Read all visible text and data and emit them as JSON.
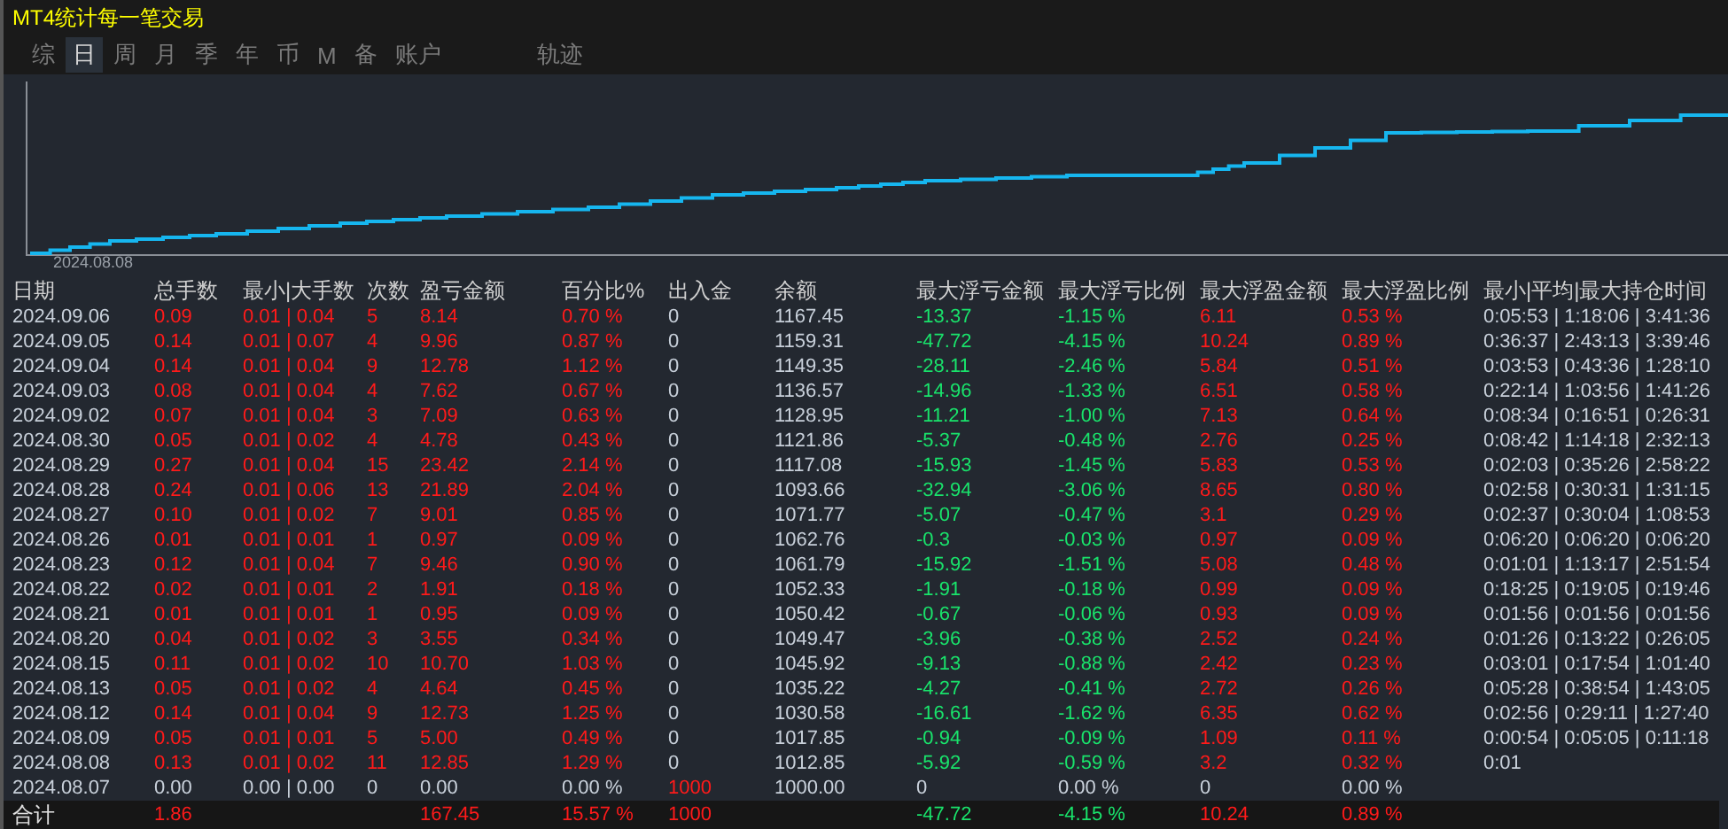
{
  "window": {
    "title": "MT4统计每一笔交易"
  },
  "tabs": [
    {
      "label": "综",
      "selected": false
    },
    {
      "label": "日",
      "selected": true
    },
    {
      "label": "周",
      "selected": false
    },
    {
      "label": "月",
      "selected": false
    },
    {
      "label": "季",
      "selected": false
    },
    {
      "label": "年",
      "selected": false
    },
    {
      "label": "币",
      "selected": false
    },
    {
      "label": "M",
      "selected": false
    },
    {
      "label": "备",
      "selected": false
    },
    {
      "label": "账户",
      "selected": false
    },
    {
      "label": "轨迹",
      "selected": false
    }
  ],
  "chart": {
    "start_label": "2024.08.08"
  },
  "table": {
    "columns": [
      "日期",
      "总手数",
      "最小|大手数",
      "次数",
      "盈亏金额",
      "百分比%",
      "出入金",
      "余额",
      "最大浮亏金额",
      "最大浮亏比例",
      "最大浮盈金额",
      "最大浮盈比例",
      "最小|平均|最大持仓时间"
    ],
    "rows": [
      {
        "cells": [
          {
            "text": "2024.09.06",
            "color": "#c8d0da"
          },
          {
            "text": "0.09",
            "color": "#ff1a1a"
          },
          {
            "text": "0.01 | 0.04",
            "color": "#ff1a1a"
          },
          {
            "text": "5",
            "color": "#ff1a1a"
          },
          {
            "text": "8.14",
            "color": "#ff1a1a"
          },
          {
            "text": "0.70 %",
            "color": "#ff1a1a"
          },
          {
            "text": "0",
            "color": "#c8d0da"
          },
          {
            "text": "1167.45",
            "color": "#c8d0da"
          },
          {
            "text": "-13.37",
            "color": "#19e36b"
          },
          {
            "text": "-1.15 %",
            "color": "#19e36b"
          },
          {
            "text": "6.11",
            "color": "#ff1a1a"
          },
          {
            "text": "0.53 %",
            "color": "#ff1a1a"
          },
          {
            "text": "0:05:53 | 1:18:06 | 3:41:36",
            "color": "#c8d0da"
          }
        ]
      },
      {
        "cells": [
          {
            "text": "2024.09.05",
            "color": "#c8d0da"
          },
          {
            "text": "0.14",
            "color": "#ff1a1a"
          },
          {
            "text": "0.01 | 0.07",
            "color": "#ff1a1a"
          },
          {
            "text": "4",
            "color": "#ff1a1a"
          },
          {
            "text": "9.96",
            "color": "#ff1a1a"
          },
          {
            "text": "0.87 %",
            "color": "#ff1a1a"
          },
          {
            "text": "0",
            "color": "#c8d0da"
          },
          {
            "text": "1159.31",
            "color": "#c8d0da"
          },
          {
            "text": "-47.72",
            "color": "#19e36b"
          },
          {
            "text": "-4.15 %",
            "color": "#19e36b"
          },
          {
            "text": "10.24",
            "color": "#ff1a1a"
          },
          {
            "text": "0.89 %",
            "color": "#ff1a1a"
          },
          {
            "text": "0:36:37 | 2:43:13 | 3:39:46",
            "color": "#c8d0da"
          }
        ]
      },
      {
        "cells": [
          {
            "text": "2024.09.04",
            "color": "#c8d0da"
          },
          {
            "text": "0.14",
            "color": "#ff1a1a"
          },
          {
            "text": "0.01 | 0.04",
            "color": "#ff1a1a"
          },
          {
            "text": "9",
            "color": "#ff1a1a"
          },
          {
            "text": "12.78",
            "color": "#ff1a1a"
          },
          {
            "text": "1.12 %",
            "color": "#ff1a1a"
          },
          {
            "text": "0",
            "color": "#c8d0da"
          },
          {
            "text": "1149.35",
            "color": "#c8d0da"
          },
          {
            "text": "-28.11",
            "color": "#19e36b"
          },
          {
            "text": "-2.46 %",
            "color": "#19e36b"
          },
          {
            "text": "5.84",
            "color": "#ff1a1a"
          },
          {
            "text": "0.51 %",
            "color": "#ff1a1a"
          },
          {
            "text": "0:03:53 | 0:43:36 | 1:28:10",
            "color": "#c8d0da"
          }
        ]
      },
      {
        "cells": [
          {
            "text": "2024.09.03",
            "color": "#c8d0da"
          },
          {
            "text": "0.08",
            "color": "#ff1a1a"
          },
          {
            "text": "0.01 | 0.04",
            "color": "#ff1a1a"
          },
          {
            "text": "4",
            "color": "#ff1a1a"
          },
          {
            "text": "7.62",
            "color": "#ff1a1a"
          },
          {
            "text": "0.67 %",
            "color": "#ff1a1a"
          },
          {
            "text": "0",
            "color": "#c8d0da"
          },
          {
            "text": "1136.57",
            "color": "#c8d0da"
          },
          {
            "text": "-14.96",
            "color": "#19e36b"
          },
          {
            "text": "-1.33 %",
            "color": "#19e36b"
          },
          {
            "text": "6.51",
            "color": "#ff1a1a"
          },
          {
            "text": "0.58 %",
            "color": "#ff1a1a"
          },
          {
            "text": "0:22:14 | 1:03:56 | 1:41:26",
            "color": "#c8d0da"
          }
        ]
      },
      {
        "cells": [
          {
            "text": "2024.09.02",
            "color": "#c8d0da"
          },
          {
            "text": "0.07",
            "color": "#ff1a1a"
          },
          {
            "text": "0.01 | 0.04",
            "color": "#ff1a1a"
          },
          {
            "text": "3",
            "color": "#ff1a1a"
          },
          {
            "text": "7.09",
            "color": "#ff1a1a"
          },
          {
            "text": "0.63 %",
            "color": "#ff1a1a"
          },
          {
            "text": "0",
            "color": "#c8d0da"
          },
          {
            "text": "1128.95",
            "color": "#c8d0da"
          },
          {
            "text": "-11.21",
            "color": "#19e36b"
          },
          {
            "text": "-1.00 %",
            "color": "#19e36b"
          },
          {
            "text": "7.13",
            "color": "#ff1a1a"
          },
          {
            "text": "0.64 %",
            "color": "#ff1a1a"
          },
          {
            "text": "0:08:34 | 0:16:51 | 0:26:31",
            "color": "#c8d0da"
          }
        ]
      },
      {
        "cells": [
          {
            "text": "2024.08.30",
            "color": "#c8d0da"
          },
          {
            "text": "0.05",
            "color": "#ff1a1a"
          },
          {
            "text": "0.01 | 0.02",
            "color": "#ff1a1a"
          },
          {
            "text": "4",
            "color": "#ff1a1a"
          },
          {
            "text": "4.78",
            "color": "#ff1a1a"
          },
          {
            "text": "0.43 %",
            "color": "#ff1a1a"
          },
          {
            "text": "0",
            "color": "#c8d0da"
          },
          {
            "text": "1121.86",
            "color": "#c8d0da"
          },
          {
            "text": "-5.37",
            "color": "#19e36b"
          },
          {
            "text": "-0.48 %",
            "color": "#19e36b"
          },
          {
            "text": "2.76",
            "color": "#ff1a1a"
          },
          {
            "text": "0.25 %",
            "color": "#ff1a1a"
          },
          {
            "text": "0:08:42 | 1:14:18 | 2:32:13",
            "color": "#c8d0da"
          }
        ]
      },
      {
        "cells": [
          {
            "text": "2024.08.29",
            "color": "#c8d0da"
          },
          {
            "text": "0.27",
            "color": "#ff1a1a"
          },
          {
            "text": "0.01 | 0.04",
            "color": "#ff1a1a"
          },
          {
            "text": "15",
            "color": "#ff1a1a"
          },
          {
            "text": "23.42",
            "color": "#ff1a1a"
          },
          {
            "text": "2.14 %",
            "color": "#ff1a1a"
          },
          {
            "text": "0",
            "color": "#c8d0da"
          },
          {
            "text": "1117.08",
            "color": "#c8d0da"
          },
          {
            "text": "-15.93",
            "color": "#19e36b"
          },
          {
            "text": "-1.45 %",
            "color": "#19e36b"
          },
          {
            "text": "5.83",
            "color": "#ff1a1a"
          },
          {
            "text": "0.53 %",
            "color": "#ff1a1a"
          },
          {
            "text": "0:02:03 | 0:35:26 | 2:58:22",
            "color": "#c8d0da"
          }
        ]
      },
      {
        "cells": [
          {
            "text": "2024.08.28",
            "color": "#c8d0da"
          },
          {
            "text": "0.24",
            "color": "#ff1a1a"
          },
          {
            "text": "0.01 | 0.06",
            "color": "#ff1a1a"
          },
          {
            "text": "13",
            "color": "#ff1a1a"
          },
          {
            "text": "21.89",
            "color": "#ff1a1a"
          },
          {
            "text": "2.04 %",
            "color": "#ff1a1a"
          },
          {
            "text": "0",
            "color": "#c8d0da"
          },
          {
            "text": "1093.66",
            "color": "#c8d0da"
          },
          {
            "text": "-32.94",
            "color": "#19e36b"
          },
          {
            "text": "-3.06 %",
            "color": "#19e36b"
          },
          {
            "text": "8.65",
            "color": "#ff1a1a"
          },
          {
            "text": "0.80 %",
            "color": "#ff1a1a"
          },
          {
            "text": "0:02:58 | 0:30:31 | 1:31:15",
            "color": "#c8d0da"
          }
        ]
      },
      {
        "cells": [
          {
            "text": "2024.08.27",
            "color": "#c8d0da"
          },
          {
            "text": "0.10",
            "color": "#ff1a1a"
          },
          {
            "text": "0.01 | 0.02",
            "color": "#ff1a1a"
          },
          {
            "text": "7",
            "color": "#ff1a1a"
          },
          {
            "text": "9.01",
            "color": "#ff1a1a"
          },
          {
            "text": "0.85 %",
            "color": "#ff1a1a"
          },
          {
            "text": "0",
            "color": "#c8d0da"
          },
          {
            "text": "1071.77",
            "color": "#c8d0da"
          },
          {
            "text": "-5.07",
            "color": "#19e36b"
          },
          {
            "text": "-0.47 %",
            "color": "#19e36b"
          },
          {
            "text": "3.1",
            "color": "#ff1a1a"
          },
          {
            "text": "0.29 %",
            "color": "#ff1a1a"
          },
          {
            "text": "0:02:37 | 0:30:04 | 1:08:53",
            "color": "#c8d0da"
          }
        ]
      },
      {
        "cells": [
          {
            "text": "2024.08.26",
            "color": "#c8d0da"
          },
          {
            "text": "0.01",
            "color": "#ff1a1a"
          },
          {
            "text": "0.01 | 0.01",
            "color": "#ff1a1a"
          },
          {
            "text": "1",
            "color": "#ff1a1a"
          },
          {
            "text": "0.97",
            "color": "#ff1a1a"
          },
          {
            "text": "0.09 %",
            "color": "#ff1a1a"
          },
          {
            "text": "0",
            "color": "#c8d0da"
          },
          {
            "text": "1062.76",
            "color": "#c8d0da"
          },
          {
            "text": "-0.3",
            "color": "#19e36b"
          },
          {
            "text": "-0.03 %",
            "color": "#19e36b"
          },
          {
            "text": "0.97",
            "color": "#ff1a1a"
          },
          {
            "text": "0.09 %",
            "color": "#ff1a1a"
          },
          {
            "text": "0:06:20 | 0:06:20 | 0:06:20",
            "color": "#c8d0da"
          }
        ]
      },
      {
        "cells": [
          {
            "text": "2024.08.23",
            "color": "#c8d0da"
          },
          {
            "text": "0.12",
            "color": "#ff1a1a"
          },
          {
            "text": "0.01 | 0.04",
            "color": "#ff1a1a"
          },
          {
            "text": "7",
            "color": "#ff1a1a"
          },
          {
            "text": "9.46",
            "color": "#ff1a1a"
          },
          {
            "text": "0.90 %",
            "color": "#ff1a1a"
          },
          {
            "text": "0",
            "color": "#c8d0da"
          },
          {
            "text": "1061.79",
            "color": "#c8d0da"
          },
          {
            "text": "-15.92",
            "color": "#19e36b"
          },
          {
            "text": "-1.51 %",
            "color": "#19e36b"
          },
          {
            "text": "5.08",
            "color": "#ff1a1a"
          },
          {
            "text": "0.48 %",
            "color": "#ff1a1a"
          },
          {
            "text": "0:01:01 | 1:13:17 | 2:51:54",
            "color": "#c8d0da"
          }
        ]
      },
      {
        "cells": [
          {
            "text": "2024.08.22",
            "color": "#c8d0da"
          },
          {
            "text": "0.02",
            "color": "#ff1a1a"
          },
          {
            "text": "0.01 | 0.01",
            "color": "#ff1a1a"
          },
          {
            "text": "2",
            "color": "#ff1a1a"
          },
          {
            "text": "1.91",
            "color": "#ff1a1a"
          },
          {
            "text": "0.18 %",
            "color": "#ff1a1a"
          },
          {
            "text": "0",
            "color": "#c8d0da"
          },
          {
            "text": "1052.33",
            "color": "#c8d0da"
          },
          {
            "text": "-1.91",
            "color": "#19e36b"
          },
          {
            "text": "-0.18 %",
            "color": "#19e36b"
          },
          {
            "text": "0.99",
            "color": "#ff1a1a"
          },
          {
            "text": "0.09 %",
            "color": "#ff1a1a"
          },
          {
            "text": "0:18:25 | 0:19:05 | 0:19:46",
            "color": "#c8d0da"
          }
        ]
      },
      {
        "cells": [
          {
            "text": "2024.08.21",
            "color": "#c8d0da"
          },
          {
            "text": "0.01",
            "color": "#ff1a1a"
          },
          {
            "text": "0.01 | 0.01",
            "color": "#ff1a1a"
          },
          {
            "text": "1",
            "color": "#ff1a1a"
          },
          {
            "text": "0.95",
            "color": "#ff1a1a"
          },
          {
            "text": "0.09 %",
            "color": "#ff1a1a"
          },
          {
            "text": "0",
            "color": "#c8d0da"
          },
          {
            "text": "1050.42",
            "color": "#c8d0da"
          },
          {
            "text": "-0.67",
            "color": "#19e36b"
          },
          {
            "text": "-0.06 %",
            "color": "#19e36b"
          },
          {
            "text": "0.93",
            "color": "#ff1a1a"
          },
          {
            "text": "0.09 %",
            "color": "#ff1a1a"
          },
          {
            "text": "0:01:56 | 0:01:56 | 0:01:56",
            "color": "#c8d0da"
          }
        ]
      },
      {
        "cells": [
          {
            "text": "2024.08.20",
            "color": "#c8d0da"
          },
          {
            "text": "0.04",
            "color": "#ff1a1a"
          },
          {
            "text": "0.01 | 0.02",
            "color": "#ff1a1a"
          },
          {
            "text": "3",
            "color": "#ff1a1a"
          },
          {
            "text": "3.55",
            "color": "#ff1a1a"
          },
          {
            "text": "0.34 %",
            "color": "#ff1a1a"
          },
          {
            "text": "0",
            "color": "#c8d0da"
          },
          {
            "text": "1049.47",
            "color": "#c8d0da"
          },
          {
            "text": "-3.96",
            "color": "#19e36b"
          },
          {
            "text": "-0.38 %",
            "color": "#19e36b"
          },
          {
            "text": "2.52",
            "color": "#ff1a1a"
          },
          {
            "text": "0.24 %",
            "color": "#ff1a1a"
          },
          {
            "text": "0:01:26 | 0:13:22 | 0:26:05",
            "color": "#c8d0da"
          }
        ]
      },
      {
        "cells": [
          {
            "text": "2024.08.15",
            "color": "#c8d0da"
          },
          {
            "text": "0.11",
            "color": "#ff1a1a"
          },
          {
            "text": "0.01 | 0.02",
            "color": "#ff1a1a"
          },
          {
            "text": "10",
            "color": "#ff1a1a"
          },
          {
            "text": "10.70",
            "color": "#ff1a1a"
          },
          {
            "text": "1.03 %",
            "color": "#ff1a1a"
          },
          {
            "text": "0",
            "color": "#c8d0da"
          },
          {
            "text": "1045.92",
            "color": "#c8d0da"
          },
          {
            "text": "-9.13",
            "color": "#19e36b"
          },
          {
            "text": "-0.88 %",
            "color": "#19e36b"
          },
          {
            "text": "2.42",
            "color": "#ff1a1a"
          },
          {
            "text": "0.23 %",
            "color": "#ff1a1a"
          },
          {
            "text": "0:03:01 | 0:17:54 | 1:01:40",
            "color": "#c8d0da"
          }
        ]
      },
      {
        "cells": [
          {
            "text": "2024.08.13",
            "color": "#c8d0da"
          },
          {
            "text": "0.05",
            "color": "#ff1a1a"
          },
          {
            "text": "0.01 | 0.02",
            "color": "#ff1a1a"
          },
          {
            "text": "4",
            "color": "#ff1a1a"
          },
          {
            "text": "4.64",
            "color": "#ff1a1a"
          },
          {
            "text": "0.45 %",
            "color": "#ff1a1a"
          },
          {
            "text": "0",
            "color": "#c8d0da"
          },
          {
            "text": "1035.22",
            "color": "#c8d0da"
          },
          {
            "text": "-4.27",
            "color": "#19e36b"
          },
          {
            "text": "-0.41 %",
            "color": "#19e36b"
          },
          {
            "text": "2.72",
            "color": "#ff1a1a"
          },
          {
            "text": "0.26 %",
            "color": "#ff1a1a"
          },
          {
            "text": "0:05:28 | 0:38:54 | 1:43:05",
            "color": "#c8d0da"
          }
        ]
      },
      {
        "cells": [
          {
            "text": "2024.08.12",
            "color": "#c8d0da"
          },
          {
            "text": "0.14",
            "color": "#ff1a1a"
          },
          {
            "text": "0.01 | 0.04",
            "color": "#ff1a1a"
          },
          {
            "text": "9",
            "color": "#ff1a1a"
          },
          {
            "text": "12.73",
            "color": "#ff1a1a"
          },
          {
            "text": "1.25 %",
            "color": "#ff1a1a"
          },
          {
            "text": "0",
            "color": "#c8d0da"
          },
          {
            "text": "1030.58",
            "color": "#c8d0da"
          },
          {
            "text": "-16.61",
            "color": "#19e36b"
          },
          {
            "text": "-1.62 %",
            "color": "#19e36b"
          },
          {
            "text": "6.35",
            "color": "#ff1a1a"
          },
          {
            "text": "0.62 %",
            "color": "#ff1a1a"
          },
          {
            "text": "0:02:56 | 0:29:11 | 1:27:40",
            "color": "#c8d0da"
          }
        ]
      },
      {
        "cells": [
          {
            "text": "2024.08.09",
            "color": "#c8d0da"
          },
          {
            "text": "0.05",
            "color": "#ff1a1a"
          },
          {
            "text": "0.01 | 0.01",
            "color": "#ff1a1a"
          },
          {
            "text": "5",
            "color": "#ff1a1a"
          },
          {
            "text": "5.00",
            "color": "#ff1a1a"
          },
          {
            "text": "0.49 %",
            "color": "#ff1a1a"
          },
          {
            "text": "0",
            "color": "#c8d0da"
          },
          {
            "text": "1017.85",
            "color": "#c8d0da"
          },
          {
            "text": "-0.94",
            "color": "#19e36b"
          },
          {
            "text": "-0.09 %",
            "color": "#19e36b"
          },
          {
            "text": "1.09",
            "color": "#ff1a1a"
          },
          {
            "text": "0.11 %",
            "color": "#ff1a1a"
          },
          {
            "text": "0:00:54 | 0:05:05 | 0:11:18",
            "color": "#c8d0da"
          }
        ]
      },
      {
        "cells": [
          {
            "text": "2024.08.08",
            "color": "#c8d0da"
          },
          {
            "text": "0.13",
            "color": "#ff1a1a"
          },
          {
            "text": "0.01 | 0.02",
            "color": "#ff1a1a"
          },
          {
            "text": "11",
            "color": "#ff1a1a"
          },
          {
            "text": "12.85",
            "color": "#ff1a1a"
          },
          {
            "text": "1.29 %",
            "color": "#ff1a1a"
          },
          {
            "text": "0",
            "color": "#c8d0da"
          },
          {
            "text": "1012.85",
            "color": "#c8d0da"
          },
          {
            "text": "-5.92",
            "color": "#19e36b"
          },
          {
            "text": "-0.59 %",
            "color": "#19e36b"
          },
          {
            "text": "3.2",
            "color": "#ff1a1a"
          },
          {
            "text": "0.32 %",
            "color": "#ff1a1a"
          },
          {
            "text": "0:01",
            "color": "#c8d0da"
          }
        ]
      },
      {
        "cells": [
          {
            "text": "2024.08.07",
            "color": "#c8d0da"
          },
          {
            "text": "0.00",
            "color": "#c8d0da"
          },
          {
            "text": "0.00 | 0.00",
            "color": "#c8d0da"
          },
          {
            "text": "0",
            "color": "#c8d0da"
          },
          {
            "text": "0.00",
            "color": "#c8d0da"
          },
          {
            "text": "0.00 %",
            "color": "#c8d0da"
          },
          {
            "text": "1000",
            "color": "#ff1a1a"
          },
          {
            "text": "1000.00",
            "color": "#c8d0da"
          },
          {
            "text": "0",
            "color": "#c8d0da"
          },
          {
            "text": "0.00 %",
            "color": "#c8d0da"
          },
          {
            "text": "0",
            "color": "#c8d0da"
          },
          {
            "text": "0.00 %",
            "color": "#c8d0da"
          }
        ]
      }
    ],
    "total": {
      "label": {
        "text": "合计",
        "color": "#e0e0e0"
      },
      "total_lots": {
        "text": "1.86",
        "color": "#ff1a1a"
      },
      "profit": {
        "text": "167.45",
        "color": "#ff1a1a"
      },
      "percent": {
        "text": "15.57 %",
        "color": "#ff1a1a"
      },
      "deposit": {
        "text": "1000",
        "color": "#ff1a1a"
      },
      "max_float_loss": {
        "text": "-47.72",
        "color": "#19e36b"
      },
      "max_float_loss_ratio": {
        "text": "-4.15 %",
        "color": "#19e36b"
      },
      "max_float_profit": {
        "text": "10.24",
        "color": "#ff1a1a"
      },
      "max_float_profit_ratio": {
        "text": "0.89 %",
        "color": "#ff1a1a"
      }
    }
  }
}
